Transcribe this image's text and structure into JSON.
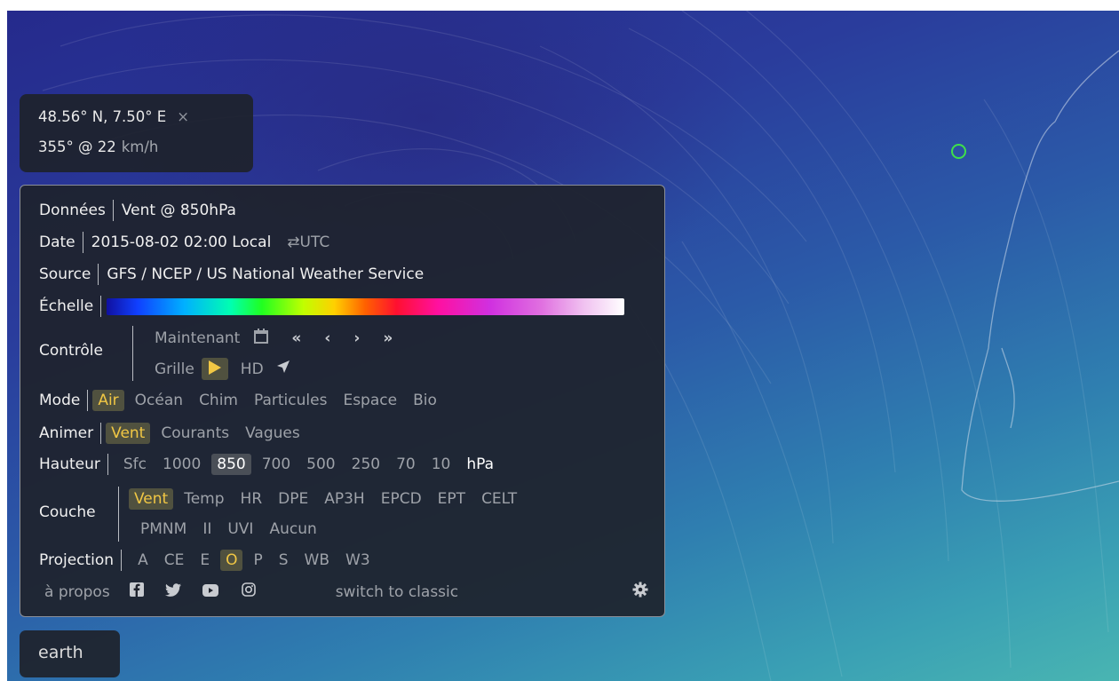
{
  "spot": {
    "coords": "48.56° N, 7.50° E",
    "close": "×",
    "wind": "355° @ 22",
    "unit": "km/h"
  },
  "menu": {
    "donnees": {
      "label": "Données",
      "value": "Vent @ 850hPa"
    },
    "date": {
      "label": "Date",
      "value": "2015-08-02 02:00 Local",
      "toggle": "⇄UTC"
    },
    "source": {
      "label": "Source",
      "value": "GFS / NCEP / US National Weather Service"
    },
    "echelle": {
      "label": "Échelle"
    },
    "controle": {
      "label": "Contrôle",
      "now": "Maintenant",
      "grid": "Grille",
      "hd": "HD",
      "nav": [
        "«",
        "‹",
        "›",
        "»"
      ]
    },
    "mode": {
      "label": "Mode",
      "options": [
        "Air",
        "Océan",
        "Chim",
        "Particules",
        "Espace",
        "Bio"
      ],
      "active": "Air"
    },
    "animer": {
      "label": "Animer",
      "options": [
        "Vent",
        "Courants",
        "Vagues"
      ],
      "active": "Vent"
    },
    "hauteur": {
      "label": "Hauteur",
      "options": [
        "Sfc",
        "1000",
        "850",
        "700",
        "500",
        "250",
        "70",
        "10"
      ],
      "selected": "850",
      "unit": "hPa"
    },
    "couche": {
      "label": "Couche",
      "row1": [
        "Vent",
        "Temp",
        "HR",
        "DPE",
        "AP3H",
        "EPCD",
        "EPT",
        "CELT"
      ],
      "row2": [
        "PMNM",
        "II",
        "UVI",
        "Aucun"
      ],
      "active": "Vent"
    },
    "projection": {
      "label": "Projection",
      "options": [
        "A",
        "CE",
        "E",
        "O",
        "P",
        "S",
        "WB",
        "W3"
      ],
      "selected": "O"
    },
    "footer": {
      "about": "à propos",
      "classic": "switch to classic"
    }
  },
  "earth_label": "earth",
  "colors": {
    "marker": "#3fe04a",
    "active_text": "#f1c744",
    "panel_bg": "#1e222c"
  }
}
